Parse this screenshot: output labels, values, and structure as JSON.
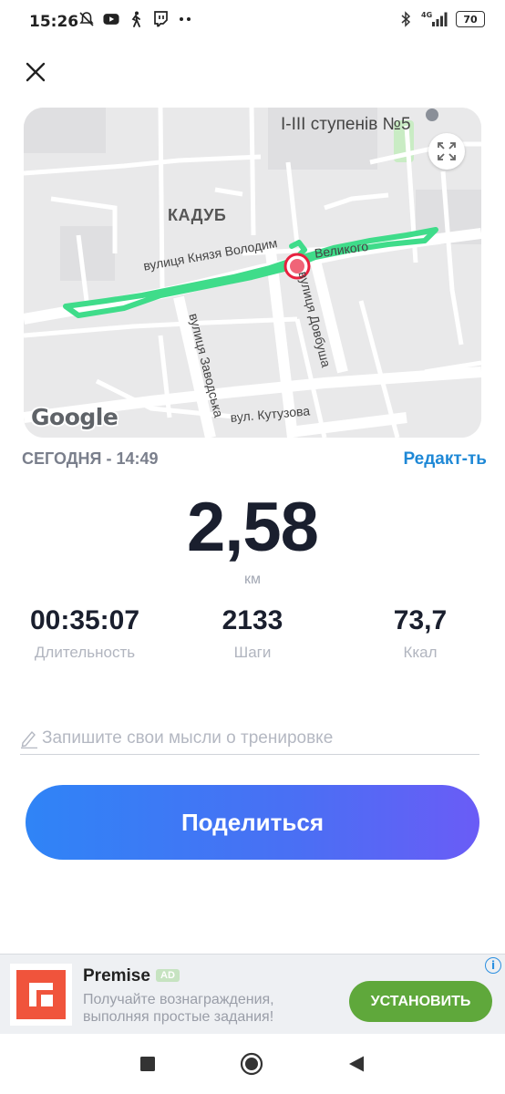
{
  "status_bar": {
    "time": "15:26",
    "network": "4G",
    "battery": "70",
    "left_icons": [
      "muted-icon",
      "youtube-icon",
      "walking-icon",
      "twitch-icon",
      "more-dots-icon"
    ],
    "right_icons": [
      "bluetooth-icon",
      "signal-icon",
      "battery-icon"
    ]
  },
  "map": {
    "labels": {
      "district": "КАДУБ",
      "school_line1": "I-III ступенів №5",
      "street_main": "вулиця Князя Володимира Великого",
      "street_main_a": "вулиця Князя Володим",
      "street_main_b": "Великого",
      "street_dovbush": "вулиця Довбуша",
      "street_zavodska": "вулиця Заводська",
      "street_kutuzova": "вул. Кутузова"
    },
    "attribution": "Google",
    "route_color": "#3fdc8a",
    "marker_color": "#e8213f"
  },
  "workout": {
    "date": "СЕГОДНЯ - 14:49",
    "edit_label": "Редакт-ть",
    "distance": "2,58",
    "distance_unit": "км",
    "stats": [
      {
        "value": "00:35:07",
        "label": "Длительность"
      },
      {
        "value": "2133",
        "label": "Шаги"
      },
      {
        "value": "73,7",
        "label": "Ккал"
      }
    ],
    "notes_placeholder": "Запишите свои мысли о тренировке",
    "share_label": "Поделиться"
  },
  "ad": {
    "title": "Premise",
    "badge": "AD",
    "description": "Получайте вознаграждения, выполняя простые задания!",
    "install_label": "УСТАНОВИТЬ",
    "info_glyph": "i",
    "logo_color": "#f0543c"
  },
  "nav": {
    "buttons": [
      "recents-square-icon",
      "home-circle-icon",
      "back-triangle-icon"
    ]
  }
}
